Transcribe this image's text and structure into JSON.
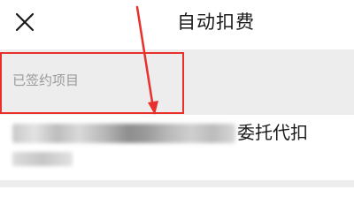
{
  "nav": {
    "title": "自动扣费"
  },
  "section": {
    "label": "已签约项目"
  },
  "list_items": [
    {
      "title": "委托代扣"
    }
  ],
  "icons": {
    "close": "close-icon"
  },
  "colors": {
    "highlight": "#e8302c",
    "section_bg": "#ededed",
    "text_primary": "#1a1a1a",
    "text_secondary": "#9a9a9a"
  }
}
